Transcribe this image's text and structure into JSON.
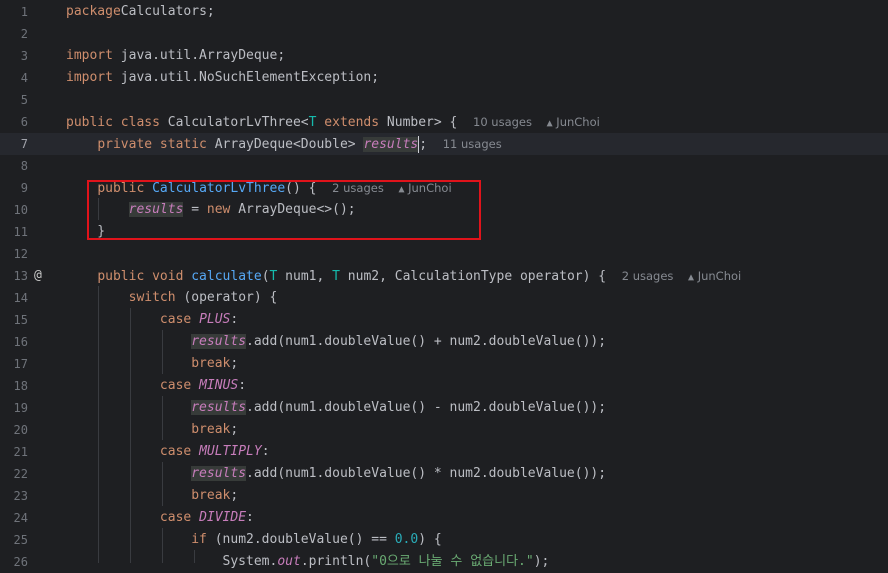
{
  "editor": {
    "lines": [
      {
        "n": "1",
        "tokens": [
          [
            "kw",
            "package"
          ],
          [
            "",
            "Calculators;"
          ]
        ]
      },
      {
        "n": "2",
        "tokens": []
      },
      {
        "n": "3",
        "tokens": [
          [
            "kw",
            "import"
          ],
          [
            "",
            " java.util.ArrayDeque;"
          ]
        ]
      },
      {
        "n": "4",
        "tokens": [
          [
            "kw",
            "import"
          ],
          [
            "",
            " java.util.NoSuchElementException;"
          ]
        ]
      },
      {
        "n": "5",
        "tokens": []
      },
      {
        "n": "6",
        "tokens": [
          [
            "kw",
            "public class "
          ],
          [
            "",
            "CalculatorLvThree<"
          ],
          [
            "tp",
            "T"
          ],
          [
            "kw",
            " extends "
          ],
          [
            "",
            "Number> {  "
          ],
          [
            "hint",
            "10 usages"
          ],
          [
            "hint",
            "    "
          ],
          [
            "icon",
            "▲"
          ],
          [
            "hint",
            " JunChoi"
          ]
        ]
      },
      {
        "n": "7",
        "current": true,
        "tokens": [
          [
            "",
            "    "
          ],
          [
            "kw",
            "private static "
          ],
          [
            "",
            "ArrayDeque<Double> "
          ],
          [
            "fldbg",
            "results"
          ],
          [
            "caret",
            ""
          ],
          [
            "",
            ";  "
          ],
          [
            "hint",
            "11 usages"
          ]
        ]
      },
      {
        "n": "8",
        "tokens": []
      },
      {
        "n": "9",
        "tokens": [
          [
            "",
            "    "
          ],
          [
            "kw",
            "public "
          ],
          [
            "fn",
            "CalculatorLvThree"
          ],
          [
            "",
            "() {  "
          ],
          [
            "hint",
            "2 usages"
          ],
          [
            "hint",
            "    "
          ],
          [
            "icon",
            "▲"
          ],
          [
            "hint",
            " JunChoi"
          ]
        ]
      },
      {
        "n": "10",
        "tokens": [
          [
            "",
            "        "
          ],
          [
            "fldbg",
            "results"
          ],
          [
            "",
            " = "
          ],
          [
            "kw",
            "new "
          ],
          [
            "",
            "ArrayDeque<>();"
          ]
        ]
      },
      {
        "n": "11",
        "tokens": [
          [
            "",
            "    }"
          ]
        ]
      },
      {
        "n": "12",
        "tokens": []
      },
      {
        "n": "13",
        "gutter": "@",
        "tokens": [
          [
            "",
            "    "
          ],
          [
            "kw",
            "public void "
          ],
          [
            "fn",
            "calculate"
          ],
          [
            "",
            "("
          ],
          [
            "tp",
            "T"
          ],
          [
            "",
            " num1, "
          ],
          [
            "tp",
            "T"
          ],
          [
            "",
            " num2, CalculationType operator) {  "
          ],
          [
            "hint",
            "2 usages"
          ],
          [
            "hint",
            "    "
          ],
          [
            "icon",
            "▲"
          ],
          [
            "hint",
            " JunChoi"
          ]
        ]
      },
      {
        "n": "14",
        "tokens": [
          [
            "",
            "        "
          ],
          [
            "kw",
            "switch "
          ],
          [
            "",
            "(operator) {"
          ]
        ]
      },
      {
        "n": "15",
        "tokens": [
          [
            "",
            "            "
          ],
          [
            "kw",
            "case "
          ],
          [
            "cst",
            "PLUS"
          ],
          [
            "",
            ":"
          ]
        ]
      },
      {
        "n": "16",
        "tokens": [
          [
            "",
            "                "
          ],
          [
            "fldbg",
            "results"
          ],
          [
            "",
            ".add(num1.doubleValue() + num2.doubleValue());"
          ]
        ]
      },
      {
        "n": "17",
        "tokens": [
          [
            "",
            "                "
          ],
          [
            "kw",
            "break"
          ],
          [
            "",
            ";"
          ]
        ]
      },
      {
        "n": "18",
        "tokens": [
          [
            "",
            "            "
          ],
          [
            "kw",
            "case "
          ],
          [
            "cst",
            "MINUS"
          ],
          [
            "",
            ":"
          ]
        ]
      },
      {
        "n": "19",
        "tokens": [
          [
            "",
            "                "
          ],
          [
            "fldbg",
            "results"
          ],
          [
            "",
            ".add(num1.doubleValue() - num2.doubleValue());"
          ]
        ]
      },
      {
        "n": "20",
        "tokens": [
          [
            "",
            "                "
          ],
          [
            "kw",
            "break"
          ],
          [
            "",
            ";"
          ]
        ]
      },
      {
        "n": "21",
        "tokens": [
          [
            "",
            "            "
          ],
          [
            "kw",
            "case "
          ],
          [
            "cst",
            "MULTIPLY"
          ],
          [
            "",
            ":"
          ]
        ]
      },
      {
        "n": "22",
        "tokens": [
          [
            "",
            "                "
          ],
          [
            "fldbg",
            "results"
          ],
          [
            "",
            ".add(num1.doubleValue() * num2.doubleValue());"
          ]
        ]
      },
      {
        "n": "23",
        "tokens": [
          [
            "",
            "                "
          ],
          [
            "kw",
            "break"
          ],
          [
            "",
            ";"
          ]
        ]
      },
      {
        "n": "24",
        "tokens": [
          [
            "",
            "            "
          ],
          [
            "kw",
            "case "
          ],
          [
            "cst",
            "DIVIDE"
          ],
          [
            "",
            ":"
          ]
        ]
      },
      {
        "n": "25",
        "tokens": [
          [
            "",
            "                "
          ],
          [
            "kw",
            "if "
          ],
          [
            "",
            "(num2.doubleValue() == "
          ],
          [
            "numlit",
            "0.0"
          ],
          [
            "",
            ") {"
          ]
        ]
      },
      {
        "n": "26",
        "tokens": [
          [
            "",
            "                    System."
          ],
          [
            "cst",
            "out"
          ],
          [
            "",
            ".println("
          ],
          [
            "str",
            "\"0으로 나눌 수 없습니다.\""
          ],
          [
            "",
            ");"
          ]
        ]
      }
    ]
  },
  "colors": {
    "background": "#1e1f22",
    "keyword": "#cf8e6d",
    "function": "#56a8f5",
    "type_param": "#16baac",
    "field": "#c77dbb",
    "number": "#2aacb8",
    "string": "#6aab73",
    "highlight_box": "#e0131b"
  }
}
